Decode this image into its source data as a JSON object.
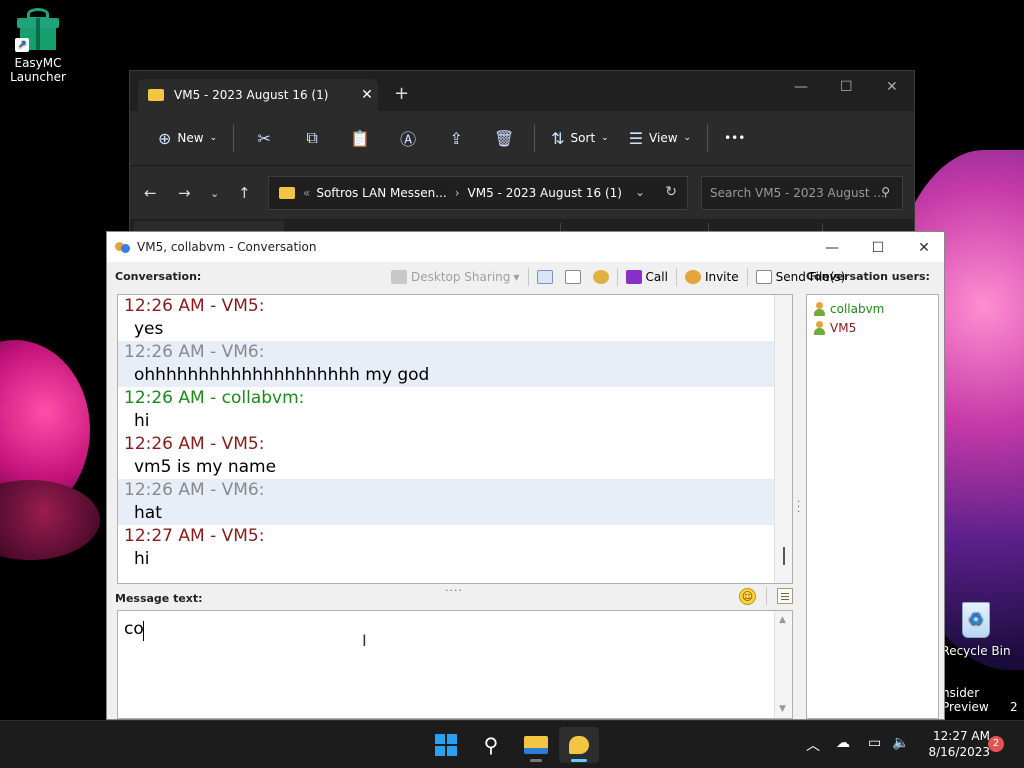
{
  "desktop": {
    "icons": [
      {
        "label": "EasyMC\nLauncher"
      },
      {
        "label": "Recycle Bin"
      }
    ],
    "watermark_line1": "nsider Preview",
    "watermark_line2": "2"
  },
  "explorer": {
    "tab_title": "VM5 - 2023 August 16 (1)",
    "toolbar": {
      "new_label": "New",
      "sort_label": "Sort",
      "view_label": "View",
      "more_label": "•••"
    },
    "breadcrumb": {
      "overflow": "«",
      "part1": "Softros LAN Messen...",
      "part2": "VM5 - 2023 August 16 (1)"
    },
    "search_placeholder": "Search VM5 - 2023 August ..."
  },
  "conversation": {
    "title": "VM5, collabvm - Conversation",
    "conversation_label": "Conversation:",
    "users_label": "Conversation users:",
    "message_label": "Message text:",
    "toolbar": {
      "desktop_sharing": "Desktop Sharing",
      "call": "Call",
      "invite": "Invite",
      "send_files": "Send File(s)"
    },
    "messages": [
      {
        "header": "12:26 AM - VM5:",
        "body": "yes",
        "color": "#8b1a1a",
        "alt": false
      },
      {
        "header": "12:26 AM - VM6:",
        "body": "ohhhhhhhhhhhhhhhhhhhh my god",
        "color": "#8a8a8a",
        "alt": true
      },
      {
        "header": "12:26 AM - collabvm:",
        "body": "hi",
        "color": "#1a8a1a",
        "alt": false
      },
      {
        "header": "12:26 AM - VM5:",
        "body": "vm5 is my name",
        "color": "#8b1a1a",
        "alt": false
      },
      {
        "header": "12:26 AM - VM6:",
        "body": "hat",
        "color": "#8a8a8a",
        "alt": true
      },
      {
        "header": "12:27 AM - VM5:",
        "body": "hi",
        "color": "#8b1a1a",
        "alt": false
      }
    ],
    "input_value": "co",
    "users": [
      {
        "name": "collabvm",
        "color": "#1a8a1a"
      },
      {
        "name": "VM5",
        "color": "#8b1a1a"
      }
    ]
  },
  "taskbar": {
    "time": "12:27 AM",
    "date": "8/16/2023",
    "notification_count": "2"
  }
}
